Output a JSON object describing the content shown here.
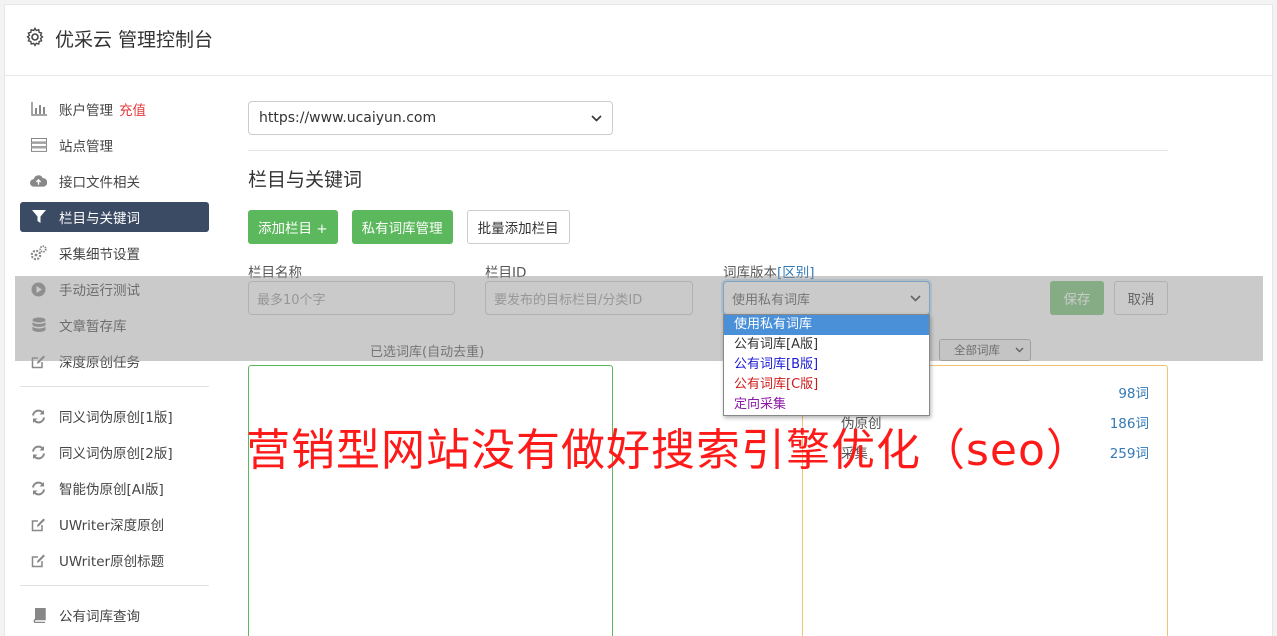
{
  "app": {
    "title": "优采云 管理控制台"
  },
  "sidebar": {
    "items": [
      {
        "label": "账户管理",
        "badge": "充值",
        "icon": "bar-chart-icon"
      },
      {
        "label": "站点管理",
        "icon": "server-icon"
      },
      {
        "label": "接口文件相关",
        "icon": "cloud-upload-icon"
      },
      {
        "label": "栏目与关键词",
        "icon": "filter-icon",
        "active": true
      },
      {
        "label": "采集细节设置",
        "icon": "gears-icon"
      },
      {
        "label": "手动运行测试",
        "icon": "play-circle-icon"
      },
      {
        "label": "文章暂存库",
        "icon": "database-icon"
      },
      {
        "label": "深度原创任务",
        "icon": "edit-icon"
      }
    ],
    "items2": [
      {
        "label": "同义词伪原创[1版]",
        "icon": "refresh-icon"
      },
      {
        "label": "同义词伪原创[2版]",
        "icon": "refresh-icon"
      },
      {
        "label": "智能伪原创[AI版]",
        "icon": "refresh-icon"
      },
      {
        "label": "UWriter深度原创",
        "icon": "edit-icon"
      },
      {
        "label": "UWriter原创标题",
        "icon": "edit-icon"
      }
    ],
    "items3": [
      {
        "label": "公有词库查询",
        "icon": "book-icon"
      }
    ]
  },
  "main": {
    "site_select": "https://www.ucaiyun.com",
    "section_title": "栏目与关键词",
    "buttons": {
      "add_column": "添加栏目 +",
      "private_lib": "私有词库管理",
      "batch_add": "批量添加栏目"
    },
    "form": {
      "name_label": "栏目名称",
      "name_placeholder": "最多10个字",
      "id_label": "栏目ID",
      "id_placeholder": "要发布的目标栏目/分类ID",
      "version_label": "词库版本",
      "version_link": "[区别]",
      "version_value": "使用私有词库",
      "save": "保存",
      "cancel": "取消"
    },
    "selected_lib_label": "已选词库(自动去重)",
    "all_lib_select": "全部词库",
    "libraries": [
      {
        "name": "",
        "count": "98词"
      },
      {
        "name": "伪原创",
        "count": "186词"
      },
      {
        "name": "采集",
        "count": "259词"
      }
    ]
  },
  "dropdown": {
    "options": [
      {
        "label": "使用私有词库",
        "color": "#ffffff",
        "highlight": true
      },
      {
        "label": "公有词库[A版]",
        "color": "#333333"
      },
      {
        "label": "公有词库[B版]",
        "color": "#1a1ad6"
      },
      {
        "label": "公有词库[C版]",
        "color": "#d01a1a"
      },
      {
        "label": "定向采集",
        "color": "#8b1aa8"
      }
    ]
  },
  "watermark": "营销型网站没有做好搜索引擎优化（seo）"
}
